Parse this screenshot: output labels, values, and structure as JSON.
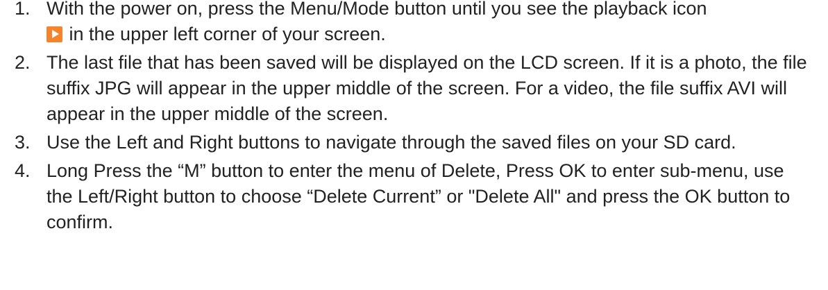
{
  "steps": [
    {
      "number": "1.",
      "text_before_icon": "With the power on, press the Menu/Mode button until you see the playback icon",
      "icon": "playback-icon",
      "text_after_icon": " in the upper left corner of your screen."
    },
    {
      "number": "2.",
      "text": "The last file that has been saved will be displayed on the LCD screen. If it is a photo, the file suffix JPG will appear in the upper middle of the screen. For a video, the file suffix AVI will appear in the upper middle of the screen."
    },
    {
      "number": "3.",
      "text": "Use the Left and Right buttons to navigate through the saved files on your SD card."
    },
    {
      "number": "4.",
      "text": "Long Press the “M” button to enter the menu of Delete, Press OK to enter sub-menu, use the Left/Right button to choose “Delete Current” or \"Delete All\" and press the OK button to confirm."
    }
  ],
  "colors": {
    "playback_icon": "#f5842d",
    "text": "#222222"
  }
}
